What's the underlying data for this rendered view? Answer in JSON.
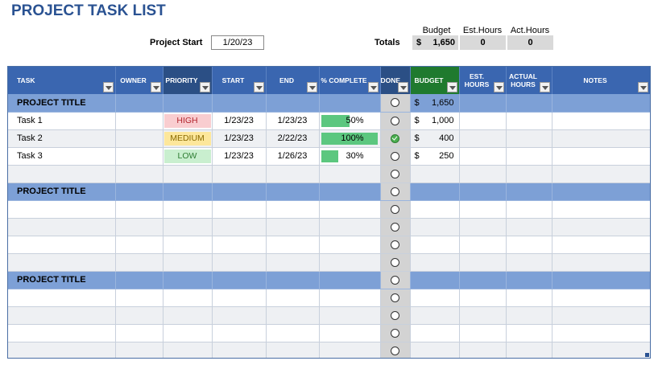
{
  "title": "PROJECT TASK LIST",
  "project_start": {
    "label": "Project Start",
    "value": "1/20/23"
  },
  "totals": {
    "label": "Totals",
    "budget_header": "Budget",
    "est_header": "Est.Hours",
    "act_header": "Act.Hours",
    "budget_currency": "$",
    "budget_value": "1,650",
    "est_value": "0",
    "act_value": "0"
  },
  "columns": {
    "task": "TASK",
    "owner": "OWNER",
    "priority": "PRIORITY",
    "start": "START",
    "end": "END",
    "pct": "% COMPLETE",
    "done": "DONE",
    "budget": "BUDGET",
    "est": "EST. HOURS",
    "actual": "ACTUAL HOURS",
    "notes": "NOTES"
  },
  "colors": {
    "title": "#2a5292",
    "header": "#3a66b0",
    "project_row": "#7da0d6",
    "budget_fill": "#c9f2c9",
    "progress": "#5cc77f",
    "high_bg": "#f9cdd0",
    "medium_bg": "#fde79b",
    "low_bg": "#c9efcf"
  },
  "sections": [
    {
      "title": "PROJECT TITLE",
      "budget_currency": "$",
      "budget": "1,650",
      "tasks": [
        {
          "name": "Task 1",
          "priority": "HIGH",
          "start": "1/23/23",
          "end": "1/23/23",
          "pct_label": "50%",
          "pct": 0.5,
          "done": false,
          "currency": "$",
          "budget": "1,000"
        },
        {
          "name": "Task 2",
          "priority": "MEDIUM",
          "start": "1/23/23",
          "end": "2/22/23",
          "pct_label": "100%",
          "pct": 1.0,
          "done": true,
          "currency": "$",
          "budget": "400"
        },
        {
          "name": "Task 3",
          "priority": "LOW",
          "start": "1/23/23",
          "end": "1/26/23",
          "pct_label": "30%",
          "pct": 0.3,
          "done": false,
          "currency": "$",
          "budget": "250"
        }
      ],
      "empty_rows": 1
    },
    {
      "title": "PROJECT TITLE",
      "tasks": [],
      "empty_rows": 4
    },
    {
      "title": "PROJECT TITLE",
      "tasks": [],
      "empty_rows": 4
    }
  ]
}
